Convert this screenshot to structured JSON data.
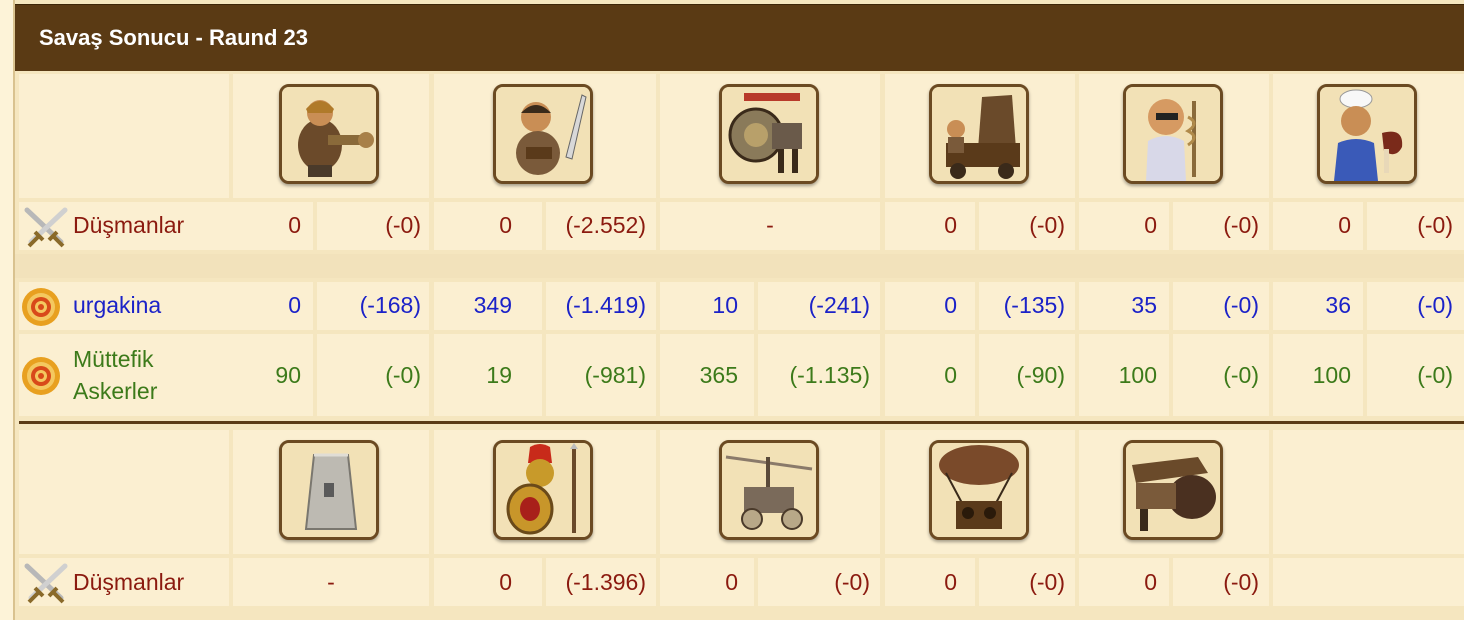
{
  "title": "Savaş Sonucu - Raund 23",
  "colors": {
    "header_bg": "#5a3a14",
    "enemy_text": "#8b1a0f",
    "player_text": "#1b22c8",
    "ally_text": "#3c7a1a"
  },
  "section1": {
    "units": [
      {
        "icon": "gunner-unit-icon"
      },
      {
        "icon": "swordsman-unit-icon"
      },
      {
        "icon": "steam-giant-unit-icon"
      },
      {
        "icon": "battering-ram-unit-icon"
      },
      {
        "icon": "doctor-unit-icon"
      },
      {
        "icon": "cook-unit-icon"
      }
    ],
    "enemies": {
      "label": "Düşmanlar",
      "icon": "crossed-swords-icon",
      "values": [
        {
          "count": "0",
          "loss": "(-0)"
        },
        {
          "count": "0",
          "loss": "(-2.552)"
        },
        {
          "dash": "-"
        },
        {
          "count": "0",
          "loss": "(-0)"
        },
        {
          "count": "0",
          "loss": "(-0)"
        },
        {
          "count": "0",
          "loss": "(-0)"
        }
      ]
    },
    "player": {
      "label": "urgakina",
      "icon": "target-icon",
      "values": [
        {
          "count": "0",
          "loss": "(-168)"
        },
        {
          "count": "349",
          "loss": "(-1.419)"
        },
        {
          "count": "10",
          "loss": "(-241)"
        },
        {
          "count": "0",
          "loss": "(-135)"
        },
        {
          "count": "35",
          "loss": "(-0)"
        },
        {
          "count": "36",
          "loss": "(-0)"
        }
      ]
    },
    "allies": {
      "label_line1": "Müttefik",
      "label_line2": "Askerler",
      "icon": "target-icon",
      "values": [
        {
          "count": "90",
          "loss": "(-0)"
        },
        {
          "count": "19",
          "loss": "(-981)"
        },
        {
          "count": "365",
          "loss": "(-1.135)"
        },
        {
          "count": "0",
          "loss": "(-90)"
        },
        {
          "count": "100",
          "loss": "(-0)"
        },
        {
          "count": "100",
          "loss": "(-0)"
        }
      ]
    }
  },
  "section2": {
    "units": [
      {
        "icon": "wall-unit-icon"
      },
      {
        "icon": "hoplite-unit-icon"
      },
      {
        "icon": "gyrocopter-unit-icon"
      },
      {
        "icon": "balloon-bomber-unit-icon"
      },
      {
        "icon": "steam-ram-unit-icon"
      }
    ],
    "enemies": {
      "label": "Düşmanlar",
      "icon": "crossed-swords-icon",
      "values": [
        {
          "dash": "-"
        },
        {
          "count": "0",
          "loss": "(-1.396)"
        },
        {
          "count": "0",
          "loss": "(-0)"
        },
        {
          "count": "0",
          "loss": "(-0)"
        },
        {
          "count": "0",
          "loss": "(-0)"
        }
      ]
    }
  }
}
